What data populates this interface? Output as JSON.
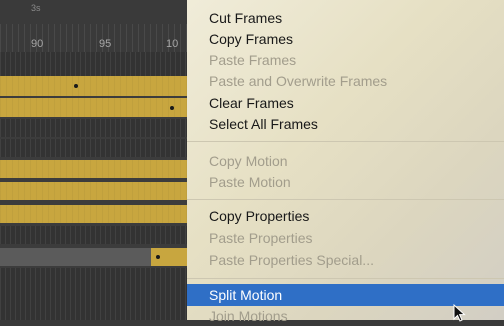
{
  "timeline": {
    "seconds_label": "3s",
    "ruler_numbers": [
      "90",
      "95",
      "10"
    ],
    "track_colors": {
      "tween": "#c8a63f",
      "empty": "#333333",
      "selected": "#5b5b5b"
    }
  },
  "context_menu": {
    "items": [
      {
        "label": "Cut Frames",
        "enabled": true
      },
      {
        "label": "Copy Frames",
        "enabled": true
      },
      {
        "label": "Paste Frames",
        "enabled": false
      },
      {
        "label": "Paste and Overwrite Frames",
        "enabled": false
      },
      {
        "label": "Clear Frames",
        "enabled": true
      },
      {
        "label": "Select All Frames",
        "enabled": true
      },
      {
        "label": "Copy Motion",
        "enabled": false
      },
      {
        "label": "Paste Motion",
        "enabled": false
      },
      {
        "label": "Copy Properties",
        "enabled": true
      },
      {
        "label": "Paste Properties",
        "enabled": false
      },
      {
        "label": "Paste Properties Special...",
        "enabled": false
      },
      {
        "label": "Split Motion",
        "enabled": true,
        "highlighted": true
      },
      {
        "label": "Join Motions",
        "enabled": false
      }
    ],
    "highlight_color": "#2f6fc6"
  }
}
